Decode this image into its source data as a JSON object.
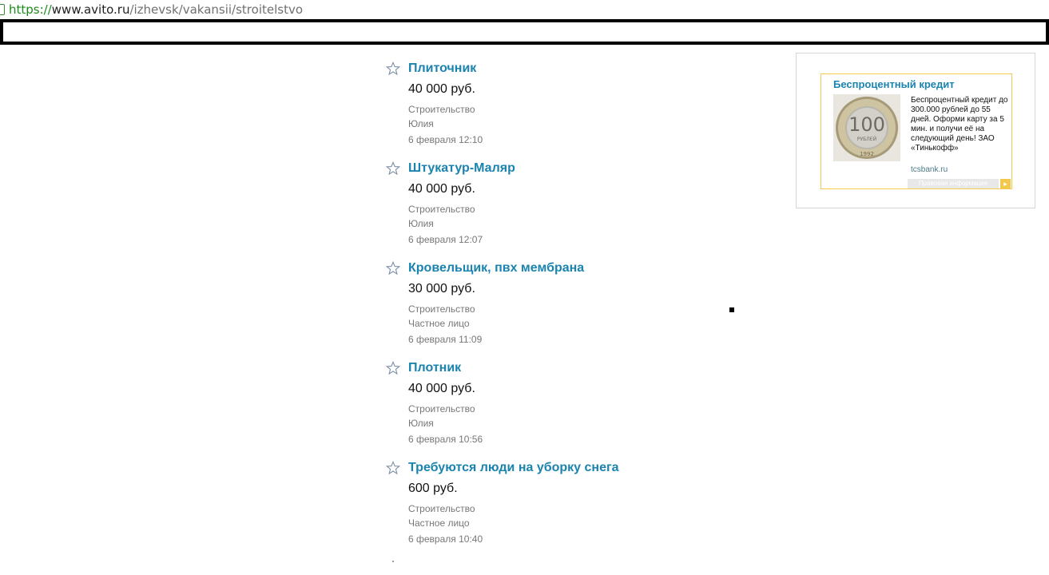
{
  "address_bar": {
    "scheme": "https://",
    "host": "www.avito.ru",
    "path": "/izhevsk/vakansii/stroitelstvo"
  },
  "listings": [
    {
      "title": "Плиточник",
      "price": "40 000 руб.",
      "category": "Строительство",
      "seller": "Юлия",
      "date": "6 февраля 12:10"
    },
    {
      "title": "Штукатур-Маляр",
      "price": "40 000 руб.",
      "category": "Строительство",
      "seller": "Юлия",
      "date": "6 февраля 12:07"
    },
    {
      "title": "Кровельщик, пвх мембрана",
      "price": "30 000 руб.",
      "category": "Строительство",
      "seller": "Частное лицо",
      "date": "6 февраля 11:09"
    },
    {
      "title": "Плотник",
      "price": "40 000 руб.",
      "category": "Строительство",
      "seller": "Юлия",
      "date": "6 февраля 10:56"
    },
    {
      "title": "Требуются люди на уборку снега",
      "price": "600 руб.",
      "category": "Строительство",
      "seller": "Частное лицо",
      "date": "6 февраля 10:40"
    }
  ],
  "ad": {
    "title": "Беспроцентный кредит",
    "text": "Беспроцентный кредит до 300.000 рублей до 55 дней. Оформи карту за 5 мин. и получи её на следующий день! ЗАО «Тинькофф»",
    "domain": "tcsbank.ru",
    "legal_label": "Правовая информация",
    "coin": {
      "value": "100",
      "word": "РУБЛЕЙ",
      "year": "1992"
    }
  },
  "icons": {
    "favorite": "star-outline-icon",
    "lock": "lock-icon"
  },
  "colors": {
    "link": "#1a83b0",
    "https": "#1a8a1a",
    "ad_border": "#f2c94c"
  }
}
